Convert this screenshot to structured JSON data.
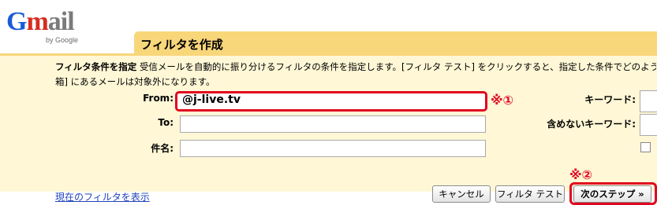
{
  "logo": {
    "letters": [
      "G",
      "m",
      "a",
      "i",
      "l"
    ],
    "byline": "by Google"
  },
  "colors": {
    "title_bar": "#f8d67a",
    "panel_bg": "#fff7d6",
    "highlight_red": "#e0061f",
    "link": "#2244bb"
  },
  "page": {
    "title": "フィルタを作成"
  },
  "description": {
    "strong": "フィルタ条件を指定",
    "line1": "受信メールを自動的に振り分けるフィルタの条件を指定します。[フィルタ テスト] をクリックすると、指定した条件でどのよう",
    "line2": "箱] にあるメールは対象外になります。"
  },
  "form": {
    "from_label": "From:",
    "from_value": "@j-live.tv",
    "to_label": "To:",
    "to_value": "",
    "subject_label": "件名:",
    "subject_value": "",
    "keyword_label": "キーワード:",
    "exclude_label": "含めないキーワード:"
  },
  "annotations": {
    "mark1": "※①",
    "mark2": "※②"
  },
  "footer": {
    "show_filters_link": "現在のフィルタを表示",
    "cancel_button": "キャンセル",
    "test_button": "フィルタ テスト",
    "next_button": "次のステップ »"
  }
}
